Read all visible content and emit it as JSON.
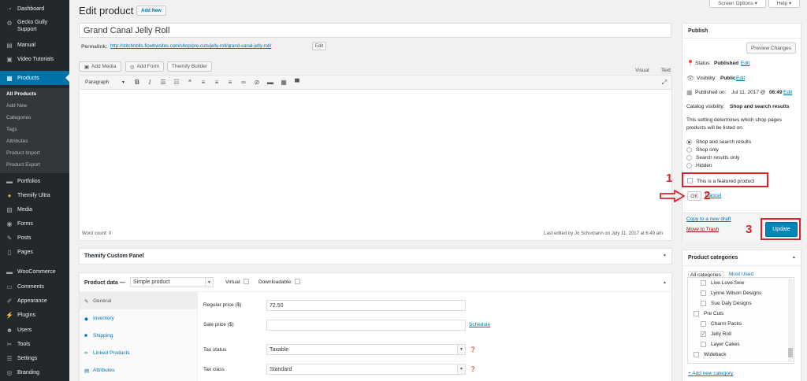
{
  "sidebar": {
    "items": [
      {
        "label": "Dashboard",
        "icon": "gauge-icon",
        "glyph": "◔"
      },
      {
        "label": "Gecko Gully Support",
        "icon": "gear-icon",
        "glyph": "⚙"
      },
      {
        "label": "Manual",
        "icon": "book-icon",
        "glyph": "▤"
      },
      {
        "label": "Video Tutorials",
        "icon": "video-icon",
        "glyph": "▣"
      },
      {
        "label": "Products",
        "icon": "products-icon",
        "glyph": "▦"
      },
      {
        "label": "Portfolios",
        "icon": "portfolio-icon",
        "glyph": "▬"
      },
      {
        "label": "Themify Ultra",
        "icon": "themify-icon",
        "glyph": "●"
      },
      {
        "label": "Media",
        "icon": "media-icon",
        "glyph": "▧"
      },
      {
        "label": "Forms",
        "icon": "forms-icon",
        "glyph": "◉"
      },
      {
        "label": "Posts",
        "icon": "pin-icon",
        "glyph": "✎"
      },
      {
        "label": "Pages",
        "icon": "pages-icon",
        "glyph": "▯"
      },
      {
        "label": "WooCommerce",
        "icon": "woocommerce-icon",
        "glyph": "▬"
      },
      {
        "label": "Comments",
        "icon": "comments-icon",
        "glyph": "▭"
      },
      {
        "label": "Appearance",
        "icon": "brush-icon",
        "glyph": "✐"
      },
      {
        "label": "Plugins",
        "icon": "plugin-icon",
        "glyph": "⚡"
      },
      {
        "label": "Users",
        "icon": "users-icon",
        "glyph": "☻"
      },
      {
        "label": "Tools",
        "icon": "wrench-icon",
        "glyph": "✂"
      },
      {
        "label": "Settings",
        "icon": "settings-icon",
        "glyph": "☰"
      },
      {
        "label": "Branding",
        "icon": "branding-icon",
        "glyph": "◎"
      }
    ],
    "products_sub": [
      "All Products",
      "Add New",
      "Categories",
      "Tags",
      "Attributes",
      "Product Import",
      "Product Export"
    ]
  },
  "header": {
    "title": "Edit product",
    "add_new": "Add New",
    "screen_options": "Screen Options ▾",
    "help": "Help ▾"
  },
  "post": {
    "title": "Grand Canal Jelly Roll",
    "permalink_label": "Permalink:",
    "permalink_url": "http://stitchnbits.fiowhwsites.com/shop/pre-cuts/jelly-roll/grand-canal-jelly-roll/",
    "permalink_edit": "Edit"
  },
  "editor": {
    "add_media": "Add Media",
    "add_form": "Add Form",
    "themify_builder": "Themify Builder",
    "tab_visual": "Visual",
    "tab_text": "Text",
    "format": "Paragraph",
    "word_count": "Word count: 0",
    "last_edited": "Last edited by Jo Schumann on July 11, 2017 at 6:49 am"
  },
  "themify_panel": {
    "title": "Themify Custom Panel"
  },
  "product_data": {
    "title": "Product data —",
    "type": "Simple product",
    "virtual": "Virtual:",
    "downloadable": "Downloadable:",
    "tabs": [
      "General",
      "Inventory",
      "Shipping",
      "Linked Products",
      "Attributes"
    ],
    "regular_price_label": "Regular price ($)",
    "regular_price": "72.50",
    "sale_price_label": "Sale price ($)",
    "schedule": "Schedule",
    "tax_status_label": "Tax status",
    "tax_status": "Taxable",
    "tax_class_label": "Tax class",
    "tax_class": "Standard"
  },
  "publish": {
    "title": "Publish",
    "preview": "Preview Changes",
    "status_label": "Status:",
    "status_value": "Published",
    "visibility_label": "Visibility:",
    "visibility_value": "Public",
    "published_label": "Published on:",
    "published_value": "Jul 11, 2017 @",
    "published_time": "06:49",
    "edit": "Edit",
    "catalog_label": "Catalog visibility:",
    "catalog_value": "Shop and search results",
    "help_text": "This setting determines which shop pages products will be listed on.",
    "options": [
      "Shop and search results",
      "Shop only",
      "Search results only",
      "Hidden"
    ],
    "featured": "This is a featured product",
    "ok": "OK",
    "cancel": "Cancel",
    "copy_draft": "Copy to a new draft",
    "trash": "Move to Trash",
    "update": "Update"
  },
  "categories": {
    "title": "Product categories",
    "tab_all": "All categories",
    "tab_used": "Most Used",
    "items": [
      {
        "label": "Live.Love.Sew",
        "checked": false
      },
      {
        "label": "Lynne Wilson Designs",
        "checked": false
      },
      {
        "label": "Sue Daly Designs",
        "checked": false
      },
      {
        "label": "Pre Cuts",
        "checked": false
      },
      {
        "label": "Charm Packs",
        "checked": false
      },
      {
        "label": "Jelly Roll",
        "checked": true
      },
      {
        "label": "Layer Cakes",
        "checked": false
      },
      {
        "label": "Wideback",
        "checked": false
      }
    ],
    "add_new": "+ Add new category"
  },
  "annotations": [
    "1",
    "2",
    "3"
  ]
}
